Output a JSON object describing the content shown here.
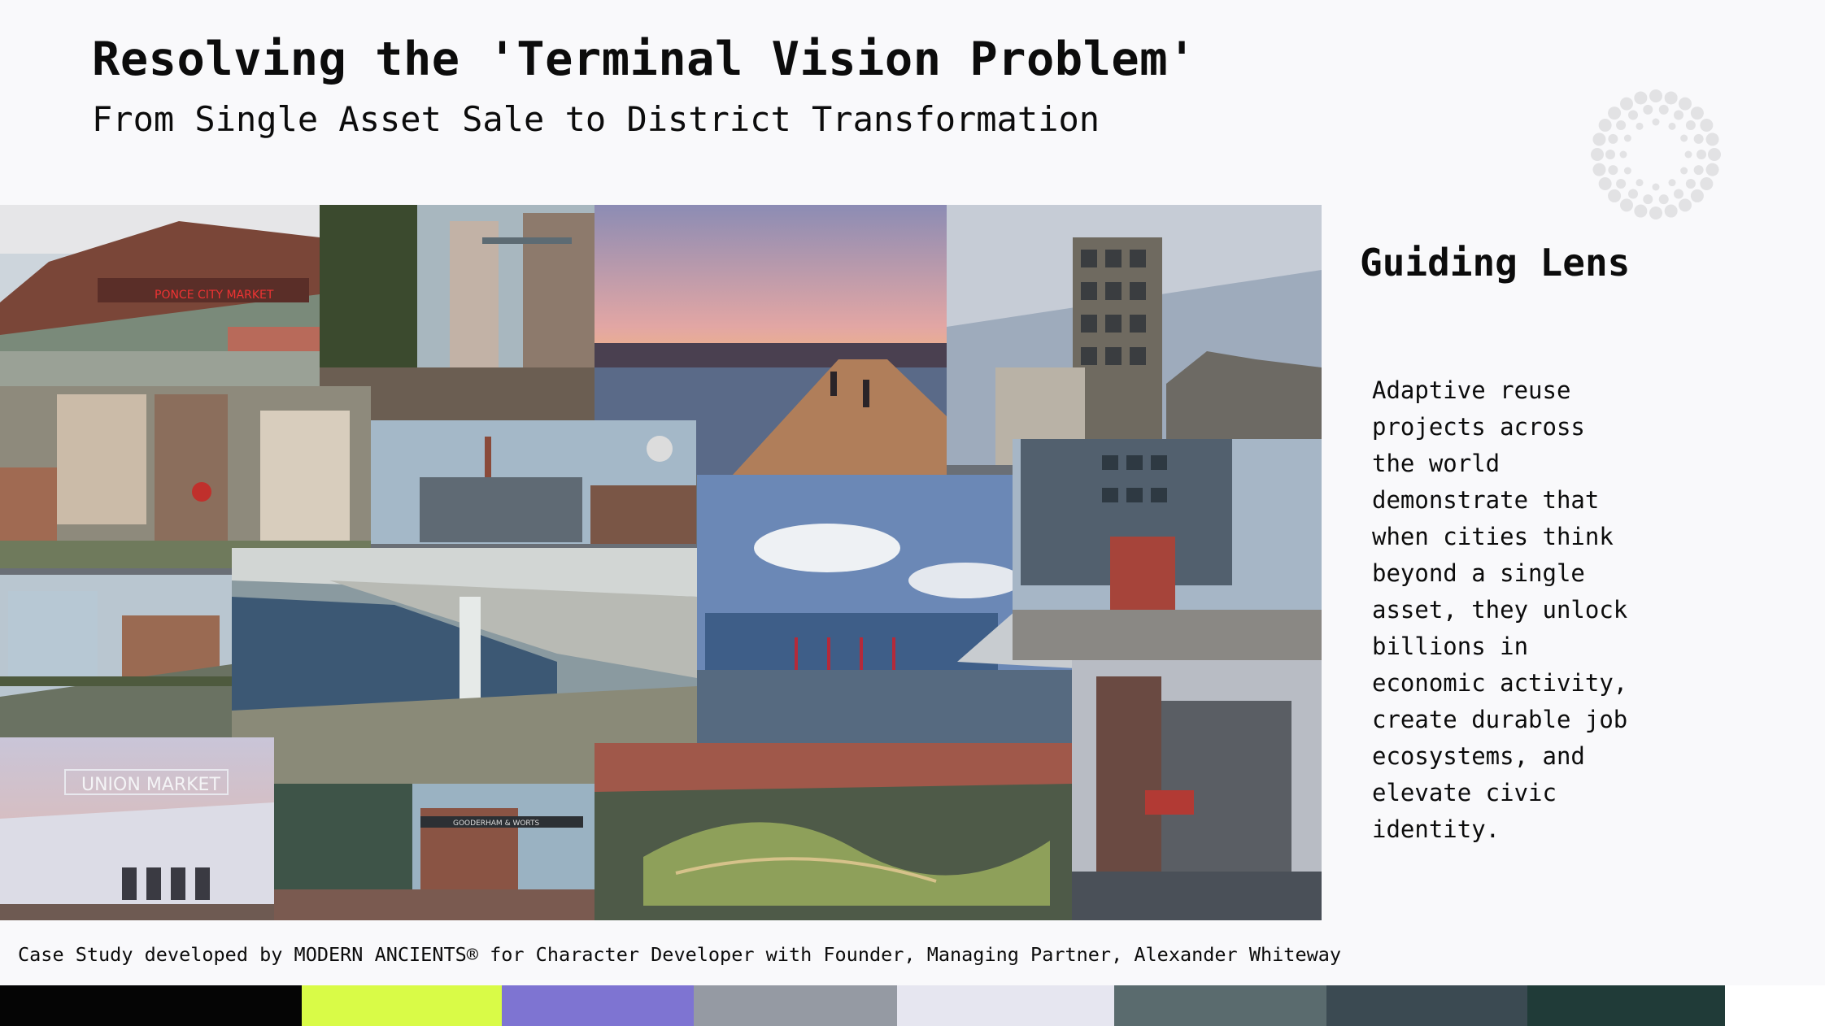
{
  "slide": {
    "title": "Resolving the 'Terminal Vision Problem'",
    "subtitle": "From Single Asset Sale to District Transformation"
  },
  "collage": {
    "photos": [
      {
        "id": "ponce-city-market",
        "sign_text": "PONCE CITY MARKET",
        "palette": [
          "#8a4a3a",
          "#c9b9a6"
        ]
      },
      {
        "id": "industrial-courtyard",
        "palette": [
          "#6a5a4e",
          "#9aa6aa"
        ]
      },
      {
        "id": "waterfront-boardwalk-dusk",
        "palette": [
          "#8a6a8c",
          "#c79a74"
        ]
      },
      {
        "id": "zeitz-silo-tower",
        "palette": [
          "#7a8696",
          "#b5b6b0"
        ]
      },
      {
        "id": "aerial-brick-district",
        "palette": [
          "#9a6e5a",
          "#b3a79a"
        ]
      },
      {
        "id": "factory-campus-render",
        "palette": [
          "#5a6e7e",
          "#a0a6a8"
        ]
      },
      {
        "id": "harbour-glass-building",
        "palette": [
          "#4a6a9a",
          "#c2ccd6"
        ]
      },
      {
        "id": "brick-loft-plaza",
        "palette": [
          "#58626e",
          "#9aa0a6"
        ]
      },
      {
        "id": "high-line-walk",
        "palette": [
          "#72828e",
          "#b7c1c8"
        ]
      },
      {
        "id": "pier-tower-render",
        "palette": [
          "#3e5a6e",
          "#a9b2b4"
        ]
      },
      {
        "id": "union-market",
        "sign_text": "UNION MARKET",
        "palette": [
          "#b7b9c6",
          "#e0d8e2"
        ]
      },
      {
        "id": "distillery-district",
        "sign_text": "GOODERHAM & WORTS",
        "palette": [
          "#6a5044",
          "#a48f80"
        ]
      },
      {
        "id": "river-wetland-park",
        "palette": [
          "#5a6a3a",
          "#8b7a6a"
        ]
      },
      {
        "id": "riverside-theater-block",
        "palette": [
          "#6a4e44",
          "#8d8884"
        ]
      }
    ]
  },
  "sidebar": {
    "heading": "Guiding Lens",
    "body": "Adaptive reuse\nprojects across\nthe world\ndemonstrate that\nwhen cities think\nbeyond a single\nasset, they unlock\nbillions in\neconomic activity,\ncreate durable job\necosystems, and\nelevate civic\nidentity."
  },
  "footer": {
    "caption": "Case Study developed by MODERN ANCIENTS® for Character Developer with Founder, Managing Partner, Alexander Whiteway"
  },
  "palette": [
    {
      "name": "black",
      "color": "#050505",
      "weight": 259
    },
    {
      "name": "lime",
      "color": "#d9fb47",
      "weight": 172
    },
    {
      "name": "lavender",
      "color": "#7e74d2",
      "weight": 165
    },
    {
      "name": "grey",
      "color": "#959aa3",
      "weight": 175
    },
    {
      "name": "mist",
      "color": "#e6e6f0",
      "weight": 186
    },
    {
      "name": "slate-teal",
      "color": "#5a6b6e",
      "weight": 183
    },
    {
      "name": "charcoal-blue",
      "color": "#3b4a52",
      "weight": 172
    },
    {
      "name": "deep-green",
      "color": "#203b38",
      "weight": 170
    },
    {
      "name": "white",
      "color": "#ffffff",
      "weight": 86
    }
  ]
}
